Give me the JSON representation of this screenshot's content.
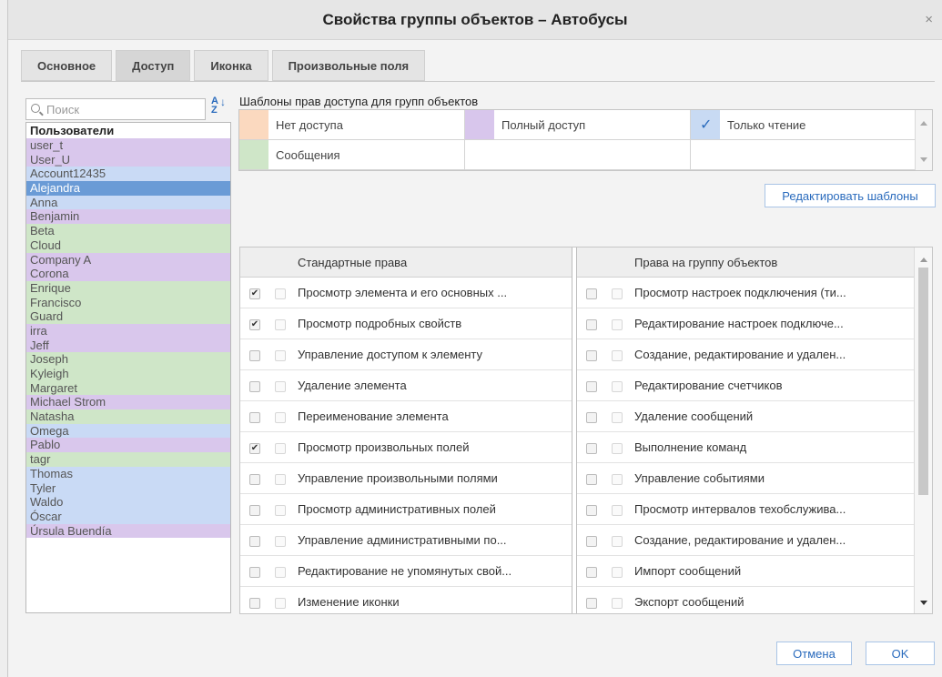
{
  "dialog": {
    "title": "Свойства группы объектов – Автобусы",
    "close_glyph": "×"
  },
  "tabs": [
    {
      "label": "Основное",
      "active": false
    },
    {
      "label": "Доступ",
      "active": true
    },
    {
      "label": "Иконка",
      "active": false
    },
    {
      "label": "Произвольные поля",
      "active": false
    }
  ],
  "search": {
    "placeholder": "Поиск",
    "value": ""
  },
  "sort_button": {
    "glyph": "A Z",
    "icon": "sort-az-icon"
  },
  "users": {
    "header": "Пользователи",
    "items": [
      {
        "name": "user_t",
        "color": "#d9c7ec"
      },
      {
        "name": "User_U",
        "color": "#d9c7ec"
      },
      {
        "name": "Account12435",
        "color": "#c9daf5"
      },
      {
        "name": "Alejandra",
        "color": "#6a9bd6",
        "selected": true
      },
      {
        "name": "Anna",
        "color": "#c9daf5"
      },
      {
        "name": "Benjamin",
        "color": "#d9c7ec"
      },
      {
        "name": "Beta",
        "color": "#cfe6c8"
      },
      {
        "name": "Cloud",
        "color": "#cfe6c8"
      },
      {
        "name": "Company A",
        "color": "#d9c7ec"
      },
      {
        "name": "Corona",
        "color": "#d9c7ec"
      },
      {
        "name": "Enrique",
        "color": "#cfe6c8"
      },
      {
        "name": "Francisco",
        "color": "#cfe6c8"
      },
      {
        "name": "Guard",
        "color": "#cfe6c8"
      },
      {
        "name": "irra",
        "color": "#d9c7ec"
      },
      {
        "name": "Jeff",
        "color": "#d9c7ec"
      },
      {
        "name": "Joseph",
        "color": "#cfe6c8"
      },
      {
        "name": "Kyleigh",
        "color": "#cfe6c8"
      },
      {
        "name": "Margaret",
        "color": "#cfe6c8"
      },
      {
        "name": "Michael Strom",
        "color": "#d9c7ec"
      },
      {
        "name": "Natasha",
        "color": "#cfe6c8"
      },
      {
        "name": "Omega",
        "color": "#c9daf5"
      },
      {
        "name": "Pablo",
        "color": "#d9c7ec"
      },
      {
        "name": "tagr",
        "color": "#cfe6c8"
      },
      {
        "name": "Thomas",
        "color": "#c9daf5"
      },
      {
        "name": "Tyler",
        "color": "#c9daf5"
      },
      {
        "name": "Waldo",
        "color": "#c9daf5"
      },
      {
        "name": "Óscar",
        "color": "#c9daf5"
      },
      {
        "name": "Úrsula Buendía",
        "color": "#d9c7ec"
      }
    ]
  },
  "templates": {
    "label": "Шаблоны прав доступа для групп объектов",
    "items": [
      {
        "label": "Нет доступа",
        "color": "#fbd9bf",
        "checked": false
      },
      {
        "label": "Полный доступ",
        "color": "#d8c6ec",
        "checked": false
      },
      {
        "label": "Только чтение",
        "color": "#c8daf3",
        "checked": true
      },
      {
        "label": "Сообщения",
        "color": "#cfe6c8",
        "checked": false
      }
    ],
    "edit_button": "Редактировать шаблоны"
  },
  "rights": {
    "standard": {
      "header": "Стандартные права",
      "items": [
        {
          "label": "Просмотр элемента и его основных ...",
          "checked": true
        },
        {
          "label": "Просмотр подробных свойств",
          "checked": true
        },
        {
          "label": "Управление доступом к элементу",
          "checked": false
        },
        {
          "label": "Удаление элемента",
          "checked": false
        },
        {
          "label": "Переименование элемента",
          "checked": false
        },
        {
          "label": "Просмотр произвольных полей",
          "checked": true
        },
        {
          "label": "Управление произвольными полями",
          "checked": false
        },
        {
          "label": "Просмотр административных полей",
          "checked": false
        },
        {
          "label": "Управление административными по...",
          "checked": false
        },
        {
          "label": "Редактирование не упомянутых свой...",
          "checked": false
        },
        {
          "label": "Изменение иконки",
          "checked": false
        }
      ]
    },
    "group": {
      "header": "Права на группу объектов",
      "items": [
        {
          "label": "Просмотр настроек подключения (ти...",
          "checked": false
        },
        {
          "label": "Редактирование настроек подключе...",
          "checked": false
        },
        {
          "label": "Создание, редактирование и удален...",
          "checked": false
        },
        {
          "label": "Редактирование счетчиков",
          "checked": false
        },
        {
          "label": "Удаление сообщений",
          "checked": false
        },
        {
          "label": "Выполнение команд",
          "checked": false
        },
        {
          "label": "Управление событиями",
          "checked": false
        },
        {
          "label": "Просмотр интервалов техобслужива...",
          "checked": false
        },
        {
          "label": "Создание, редактирование и удален...",
          "checked": false
        },
        {
          "label": "Импорт сообщений",
          "checked": false
        },
        {
          "label": "Экспорт сообщений",
          "checked": false
        }
      ]
    }
  },
  "footer": {
    "cancel": "Отмена",
    "ok": "OK"
  }
}
